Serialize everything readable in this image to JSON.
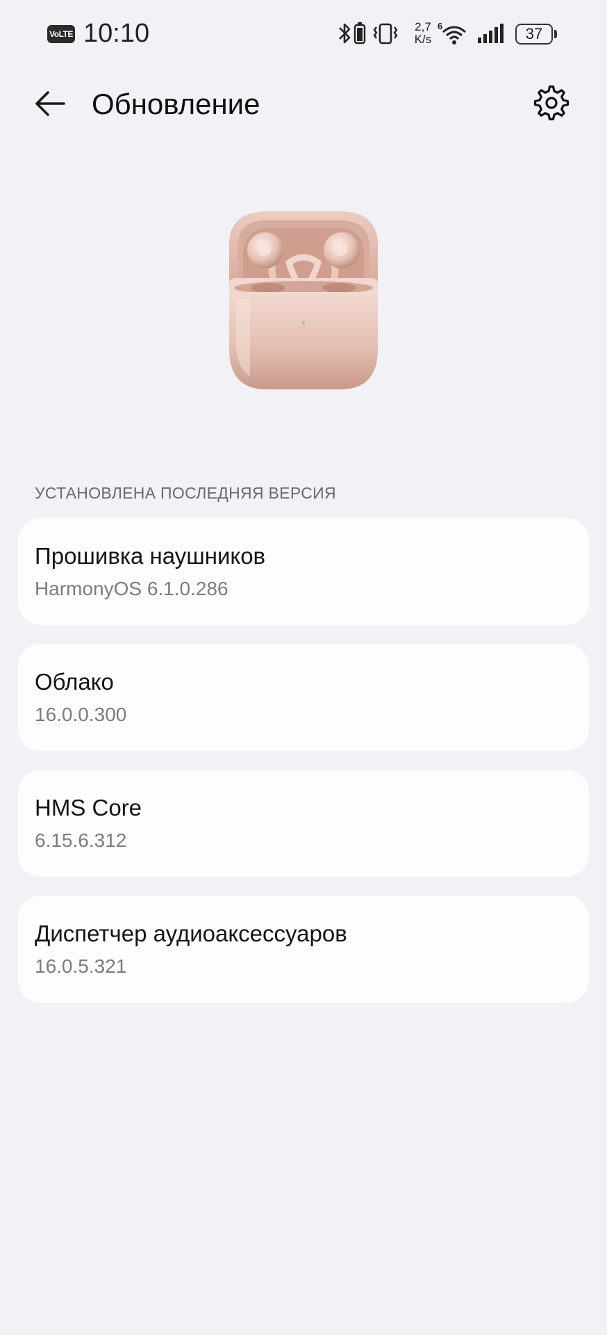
{
  "status_bar": {
    "volte": "VoLTE",
    "time": "10:10",
    "net_speed_value": "2,7",
    "net_speed_unit": "K/s",
    "battery": "37",
    "icons": [
      "bluetooth-icon",
      "headset-battery-icon",
      "vibrate-icon",
      "wifi-6-icon",
      "signal-icon",
      "battery-icon"
    ]
  },
  "header": {
    "title": "Обновление",
    "back_icon": "arrow-left-icon",
    "settings_icon": "gear-icon"
  },
  "product": {
    "image": "earbuds-case-image",
    "color": "#e7c3b7"
  },
  "section": {
    "header": "УСТАНОВЛЕНА ПОСЛЕДНЯЯ ВЕРСИЯ"
  },
  "items": [
    {
      "title": "Прошивка наушников",
      "version": "HarmonyOS 6.1.0.286"
    },
    {
      "title": "Облако",
      "version": "16.0.0.300"
    },
    {
      "title": "HMS Core",
      "version": "6.15.6.312"
    },
    {
      "title": "Диспетчер аудиоаксессуаров",
      "version": "16.0.5.321"
    }
  ],
  "colors": {
    "background": "#f1f1f6",
    "card": "#fdfdfe",
    "secondary_text": "#7b7b80"
  }
}
